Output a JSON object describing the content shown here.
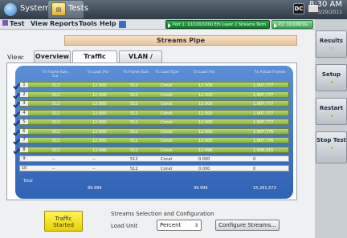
{
  "topbar": {
    "system_label": "System",
    "tests_label": "Tests",
    "time": "8:30 AM",
    "date": "3/29/2011",
    "dc_badge": "DC"
  },
  "menu": {
    "items": [
      "Test",
      "View",
      "Reports",
      "Tools",
      "Help"
    ]
  },
  "ports": [
    {
      "label": "Port 1: 10/100/1000 Eth Layer 2 Streams Term"
    },
    {
      "label": "P2: 10/100/1G"
    }
  ],
  "page_title": "Streams Pipe",
  "view": {
    "label": "View:",
    "tabs": [
      "Overview",
      "Traffic Loads",
      "VLAN / VPLS"
    ],
    "active_tab": "Traffic Loads"
  },
  "table": {
    "headers": [
      "Tx Frame Size, Cur",
      "Tx Load (%)",
      "Tx Frame Size",
      "Tx Load Type",
      "Tx Load (%)",
      "Tx Actual Frames"
    ],
    "rows": [
      {
        "idx": "1",
        "c1": "512",
        "c2": "12.500",
        "c3": "512",
        "c4": "Const",
        "c5": "12.500",
        "c6": "1,907,777",
        "enabled": true
      },
      {
        "idx": "2",
        "c1": "512",
        "c2": "12.500",
        "c3": "512",
        "c4": "Const",
        "c5": "12.500",
        "c6": "1,907,777",
        "enabled": true
      },
      {
        "idx": "3",
        "c1": "512",
        "c2": "12.500",
        "c3": "512",
        "c4": "Const",
        "c5": "12.500",
        "c6": "1,907,777",
        "enabled": true
      },
      {
        "idx": "4",
        "c1": "512",
        "c2": "12.500",
        "c3": "512",
        "c4": "Const",
        "c5": "12.500",
        "c6": "1,907,777",
        "enabled": true
      },
      {
        "idx": "5",
        "c1": "512",
        "c2": "12.500",
        "c3": "512",
        "c4": "Const",
        "c5": "12.500",
        "c6": "1,907,777",
        "enabled": true
      },
      {
        "idx": "6",
        "c1": "512",
        "c2": "12.500",
        "c3": "512",
        "c4": "Const",
        "c5": "12.500",
        "c6": "1,907,776",
        "enabled": true
      },
      {
        "idx": "7",
        "c1": "512",
        "c2": "12.500",
        "c3": "512",
        "c4": "Const",
        "c5": "12.500",
        "c6": "1,907,776",
        "enabled": true
      },
      {
        "idx": "8",
        "c1": "512",
        "c2": "12.496",
        "c3": "512",
        "c4": "Const",
        "c5": "12.496",
        "c6": "1,906,415",
        "enabled": true
      },
      {
        "idx": "9",
        "c1": "--",
        "c2": "--",
        "c3": "512",
        "c4": "Const",
        "c5": "0.000",
        "c6": "0",
        "enabled": false
      },
      {
        "idx": "10",
        "c1": "--",
        "c2": "--",
        "c3": "512",
        "c4": "Const",
        "c5": "0.000",
        "c6": "0",
        "enabled": false
      }
    ],
    "total_label": "Total",
    "totals": {
      "c2": "99.996",
      "c5": "99.996",
      "c6": "15,261,573"
    }
  },
  "bottom": {
    "traffic_button": "Traffic Started",
    "selection_title": "Streams Selection and Configuration",
    "load_unit_label": "Load Unit",
    "load_unit_value": "Percent",
    "configure_button": "Configure Streams..."
  },
  "sidebar": {
    "buttons": [
      "Results",
      "Setup",
      "Restart",
      "Stop Test"
    ]
  }
}
